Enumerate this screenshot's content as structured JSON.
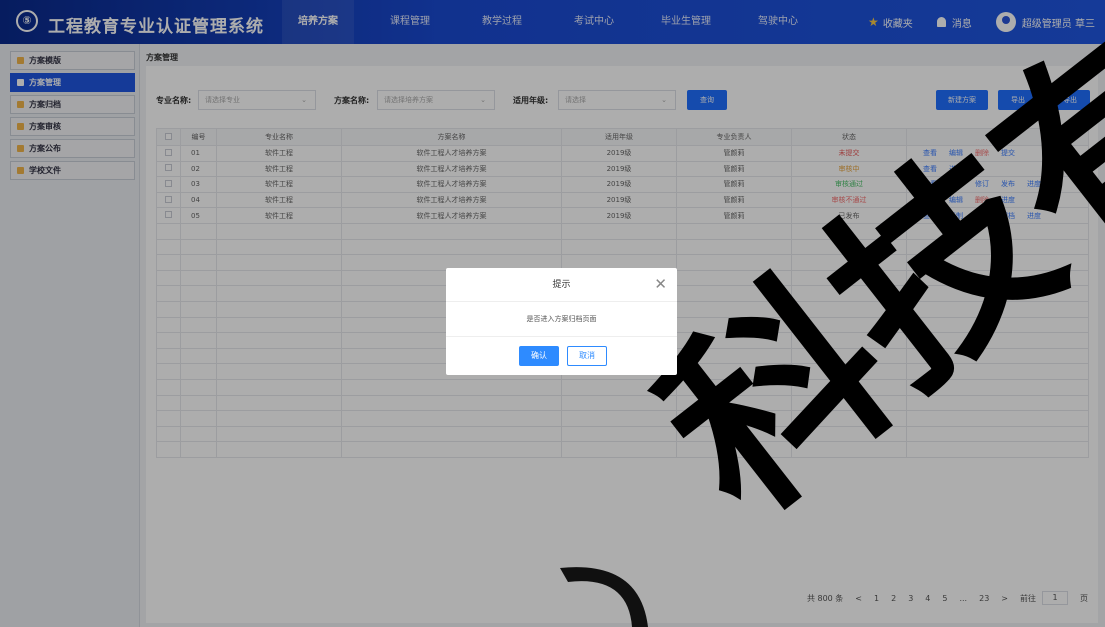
{
  "header": {
    "logo_text": "⑤",
    "title": "工程教育专业认证管理系统",
    "nav": [
      {
        "label": "培养方案",
        "active": true
      },
      {
        "label": "课程管理",
        "active": false
      },
      {
        "label": "教学过程",
        "active": false
      },
      {
        "label": "考试中心",
        "active": false
      },
      {
        "label": "毕业生管理",
        "active": false
      },
      {
        "label": "驾驶中心",
        "active": false
      }
    ],
    "favorites": "收藏夹",
    "messages": "消息",
    "user": "超级管理员 草三"
  },
  "sidebar": {
    "items": [
      {
        "label": "方案模版",
        "active": false
      },
      {
        "label": "方案管理",
        "active": true
      },
      {
        "label": "方案归档",
        "active": false
      },
      {
        "label": "方案审核",
        "active": false
      },
      {
        "label": "方案公布",
        "active": false
      },
      {
        "label": "学校文件",
        "active": false
      }
    ]
  },
  "breadcrumb": "方案管理",
  "filters": {
    "major_label": "专业名称:",
    "major_placeholder": "请选择专业",
    "plan_label": "方案名称:",
    "plan_placeholder": "请选择培养方案",
    "grade_label": "适用年级:",
    "grade_placeholder": "请选择",
    "search_btn": "查询",
    "new_btn": "新建方案",
    "import_btn": "导出",
    "export_btn": "导出"
  },
  "table": {
    "headers": [
      "编号",
      "专业名称",
      "方案名称",
      "适用年级",
      "专业负责人",
      "状态",
      "操作"
    ],
    "rows": [
      {
        "id": "01",
        "major": "软件工程",
        "plan": "软件工程人才培养方案",
        "grade": "2019级",
        "owner": "管颜莉",
        "status": "未提交",
        "status_class": "st-unsubmit",
        "ops": [
          "查看",
          "编辑",
          "删除",
          "提交"
        ]
      },
      {
        "id": "02",
        "major": "软件工程",
        "plan": "软件工程人才培养方案",
        "grade": "2019级",
        "owner": "管颜莉",
        "status": "审核中",
        "status_class": "st-review",
        "ops": [
          "查看",
          "进度"
        ]
      },
      {
        "id": "03",
        "major": "软件工程",
        "plan": "软件工程人才培养方案",
        "grade": "2019级",
        "owner": "管颜莉",
        "status": "审核通过",
        "status_class": "st-pass",
        "ops": [
          "查看",
          "编辑",
          "修订",
          "发布",
          "进度"
        ]
      },
      {
        "id": "04",
        "major": "软件工程",
        "plan": "软件工程人才培养方案",
        "grade": "2019级",
        "owner": "管颜莉",
        "status": "审核不通过",
        "status_class": "st-fail",
        "ops": [
          "查看",
          "编辑",
          "删除",
          "进度"
        ]
      },
      {
        "id": "05",
        "major": "软件工程",
        "plan": "软件工程人才培养方案",
        "grade": "2019级",
        "owner": "管颜莉",
        "status": "已发布",
        "status_class": "st-pub",
        "ops": [
          "查看",
          "复制",
          "修订",
          "归档",
          "进度"
        ]
      }
    ]
  },
  "pager": {
    "total": "共 800 条",
    "prev": "<",
    "pages": [
      "1",
      "2",
      "3",
      "4",
      "5",
      "...",
      "23"
    ],
    "next": ">",
    "goto_label": "前往",
    "goto_value": "1",
    "page_unit": "页"
  },
  "modal": {
    "title": "提示",
    "message": "是否进入方案归档页面",
    "ok": "确认",
    "cancel": "取消"
  },
  "watermark": "科技有限",
  "colors": {
    "primary": "#1f56e0",
    "accent": "#2e8bff"
  }
}
